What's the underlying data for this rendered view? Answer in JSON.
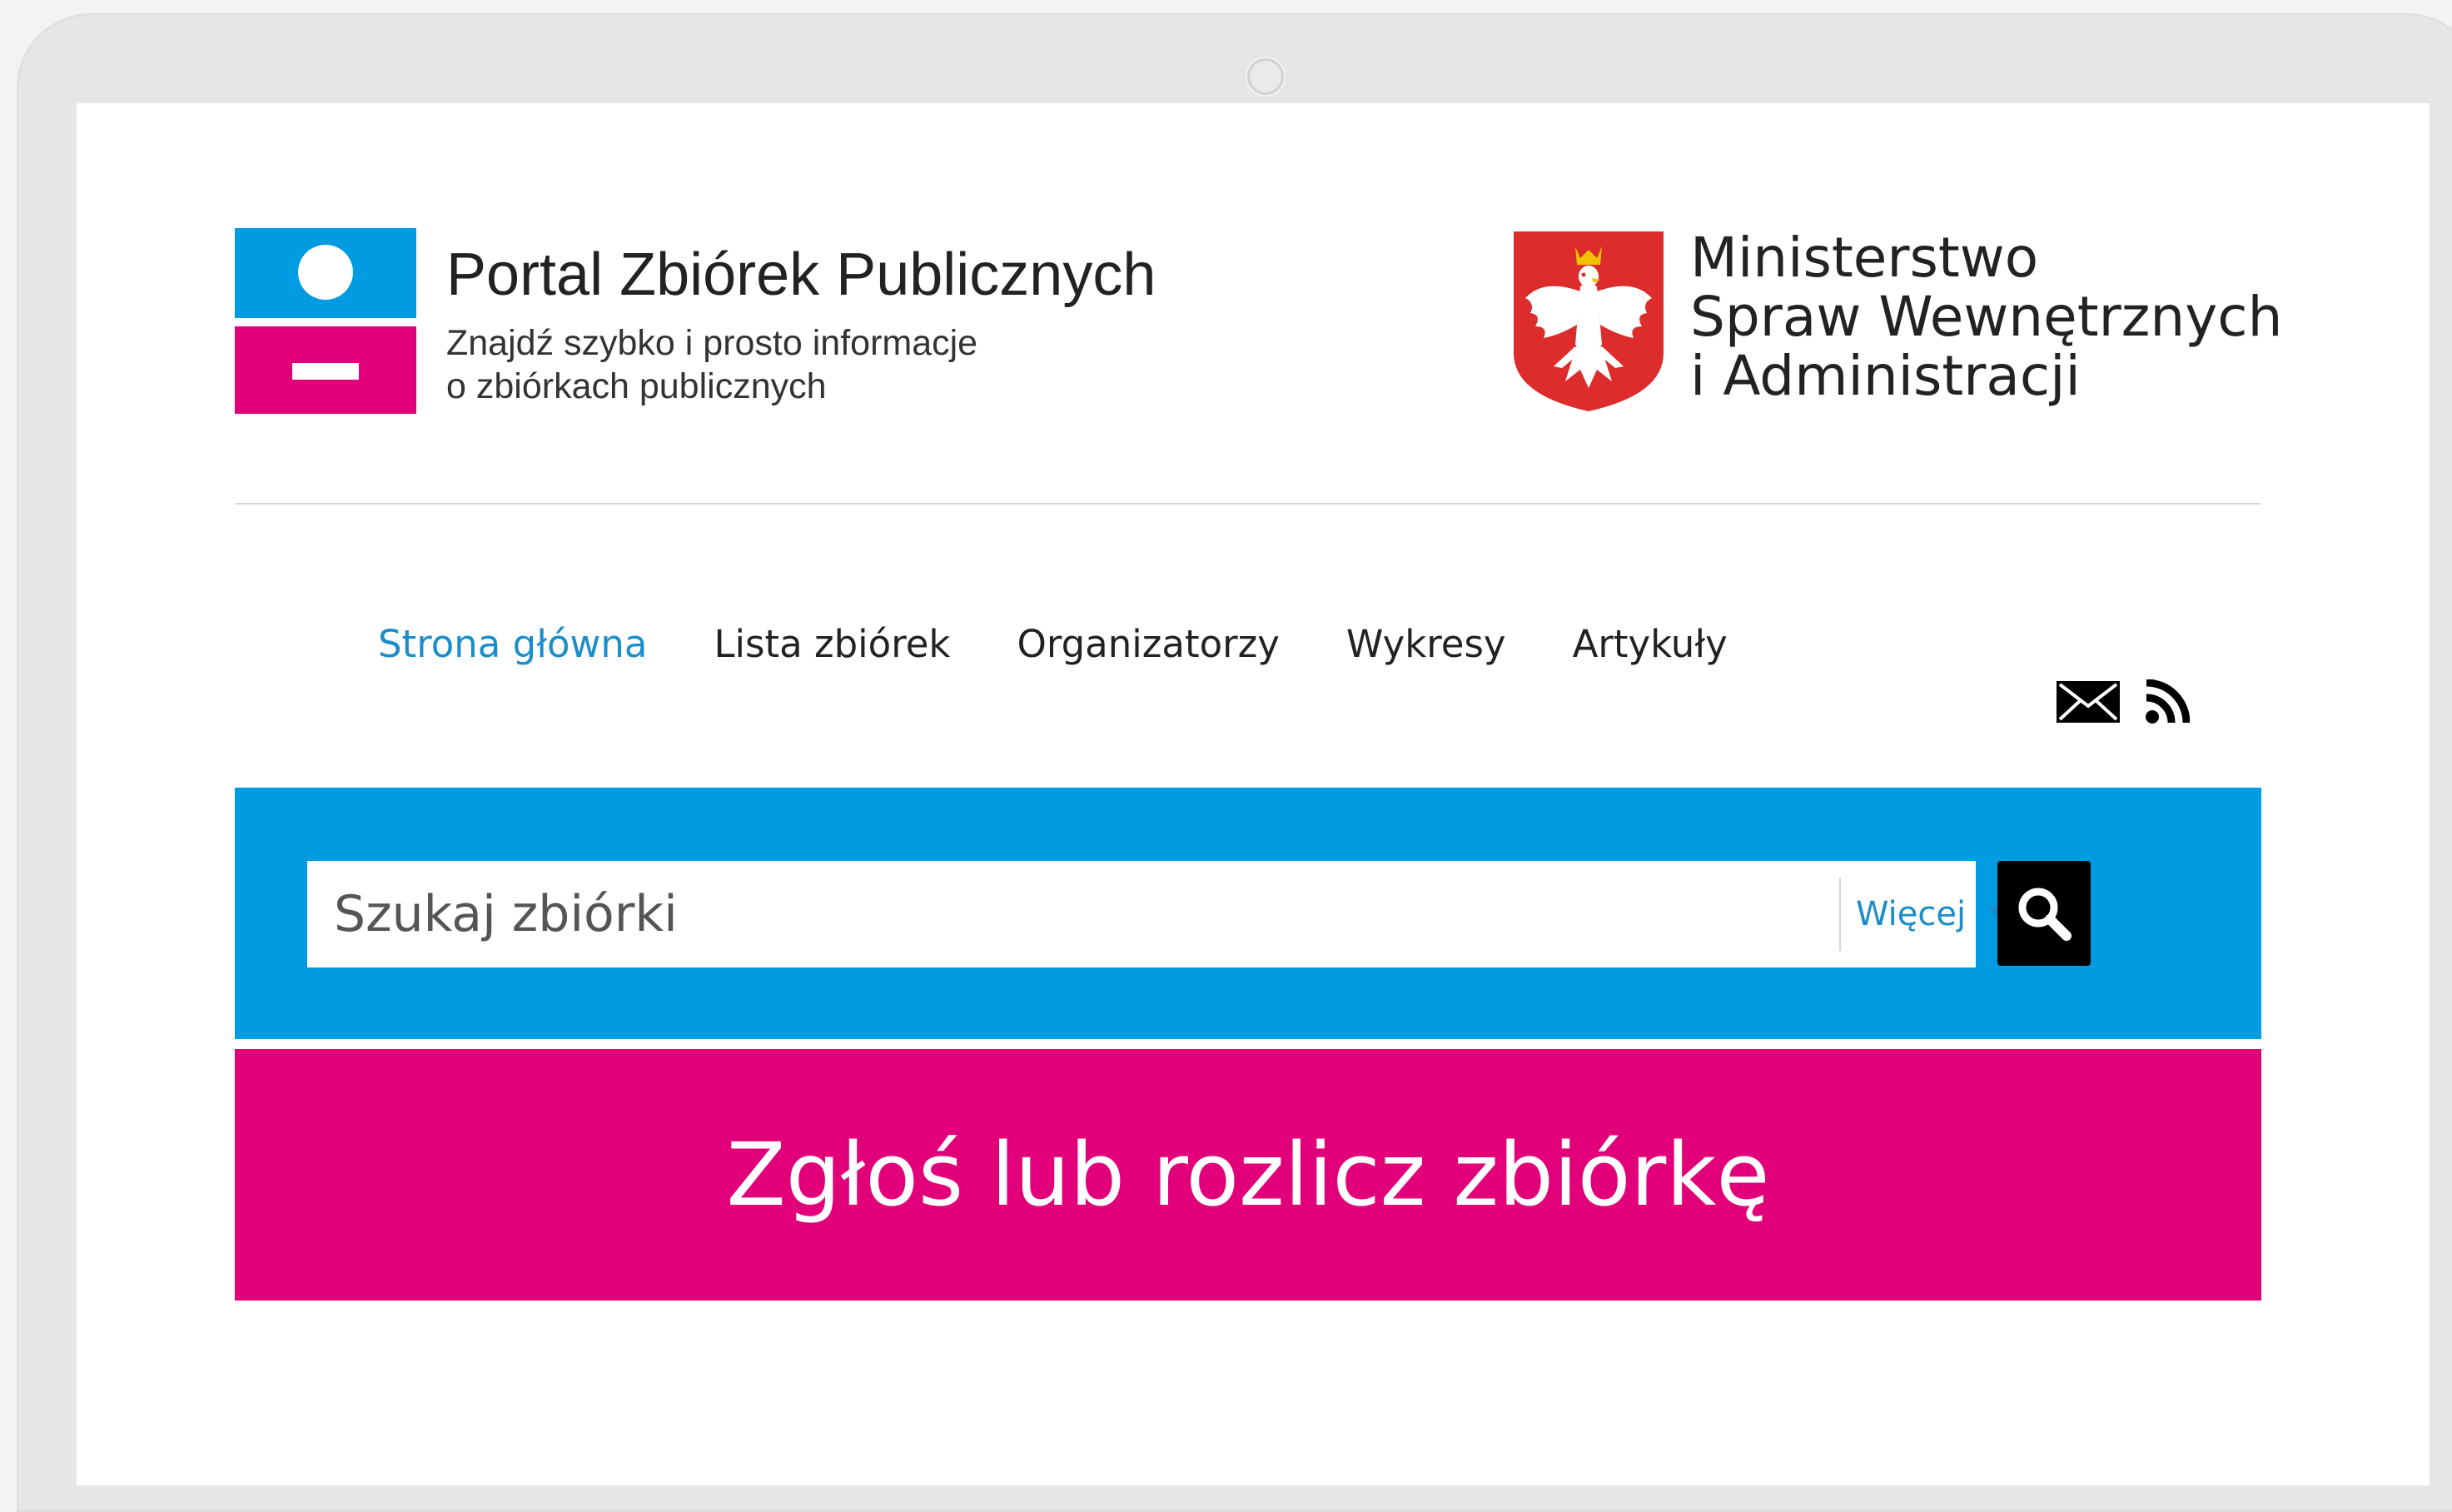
{
  "header": {
    "portal_title": "Portal Zbiórek Publicznych",
    "portal_subtitle_line1": "Znajdź szybko i prosto informacje",
    "portal_subtitle_line2": "o zbiórkach publicznych",
    "ministry_line1": "Ministerstwo",
    "ministry_line2": "Spraw Wewnętrznych",
    "ministry_line3": "i Administracji"
  },
  "nav": {
    "items": [
      {
        "label": "Strona główna",
        "active": true
      },
      {
        "label": "Lista zbiórek",
        "active": false
      },
      {
        "label": "Organizatorzy",
        "active": false
      },
      {
        "label": "Wykresy",
        "active": false
      },
      {
        "label": "Artykuły",
        "active": false
      }
    ],
    "icons": [
      "mail-icon",
      "rss-icon"
    ]
  },
  "search": {
    "placeholder": "Szukaj zbiórki",
    "value": "",
    "more_label": "Więcej",
    "button_icon": "search-icon"
  },
  "cta": {
    "label": "Zgłoś lub rozlicz zbiórkę"
  },
  "colors": {
    "brand_blue": "#009be0",
    "brand_pink": "#e2007a",
    "link_blue": "#1a8dca",
    "emblem_red": "#dc2c2c"
  }
}
